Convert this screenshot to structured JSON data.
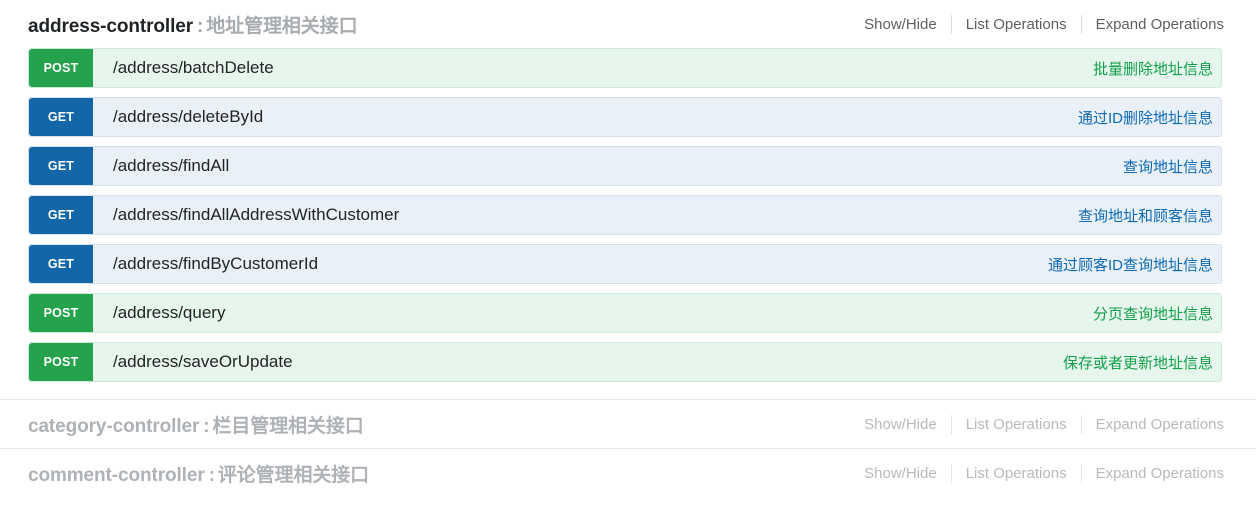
{
  "colors": {
    "get_badge": "#1367a9",
    "post_badge": "#24a34c",
    "get_row_bg": "#e9f0f8",
    "post_row_bg": "#e7f6ec",
    "get_text": "#0f6ab4",
    "post_text": "#13a04b",
    "title_dark": "#1f2326",
    "title_gray": "#a8acb0"
  },
  "options": {
    "show_hide": "Show/Hide",
    "list_operations": "List Operations",
    "expand_operations": "Expand Operations"
  },
  "resources": [
    {
      "name": "address-controller",
      "separator": ":",
      "description": "地址管理相关接口",
      "expanded": true,
      "endpoints": [
        {
          "method": "POST",
          "path": "/address/batchDelete",
          "summary": "批量删除地址信息"
        },
        {
          "method": "GET",
          "path": "/address/deleteById",
          "summary": "通过ID删除地址信息"
        },
        {
          "method": "GET",
          "path": "/address/findAll",
          "summary": "查询地址信息"
        },
        {
          "method": "GET",
          "path": "/address/findAllAddressWithCustomer",
          "summary": "查询地址和顾客信息"
        },
        {
          "method": "GET",
          "path": "/address/findByCustomerId",
          "summary": "通过顾客ID查询地址信息"
        },
        {
          "method": "POST",
          "path": "/address/query",
          "summary": "分页查询地址信息"
        },
        {
          "method": "POST",
          "path": "/address/saveOrUpdate",
          "summary": "保存或者更新地址信息"
        }
      ]
    },
    {
      "name": "category-controller",
      "separator": ":",
      "description": "栏目管理相关接口",
      "expanded": false,
      "endpoints": []
    },
    {
      "name": "comment-controller",
      "separator": ":",
      "description": "评论管理相关接口",
      "expanded": false,
      "endpoints": []
    }
  ]
}
